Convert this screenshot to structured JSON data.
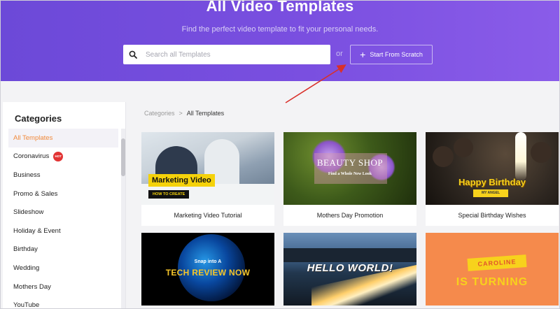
{
  "hero": {
    "title": "All Video Templates",
    "subtitle": "Find the perfect video template to fit your personal needs.",
    "search_placeholder": "Search all Templates",
    "or_label": "or",
    "scratch_button": "Start From Scratch"
  },
  "sidebar": {
    "title": "Categories",
    "items": [
      {
        "label": "All Templates",
        "active": true
      },
      {
        "label": "Coronavirus",
        "badge": "HOT"
      },
      {
        "label": "Business"
      },
      {
        "label": "Promo & Sales"
      },
      {
        "label": "Slideshow"
      },
      {
        "label": "Holiday & Event"
      },
      {
        "label": "Birthday"
      },
      {
        "label": "Wedding"
      },
      {
        "label": "Mothers Day"
      },
      {
        "label": "YouTube"
      }
    ]
  },
  "breadcrumb": {
    "root": "Categories",
    "separator": ">",
    "current": "All Templates"
  },
  "cards": [
    {
      "title": "Marketing Video Tutorial",
      "thumb_text": [
        "Marketing Video",
        "HOW TO CREATE"
      ]
    },
    {
      "title": "Mothers Day Promotion",
      "thumb_text": [
        "BEAUTY SHOP",
        "Find a Whole New Look"
      ]
    },
    {
      "title": "Special Birthday Wishes",
      "thumb_text": [
        "Happy Birthday",
        "MY ANGEL"
      ]
    },
    {
      "title": "",
      "thumb_text": [
        "Snap into A",
        "TECH REVIEW NOW"
      ]
    },
    {
      "title": "",
      "thumb_text": [
        "HELLO WORLD!"
      ]
    },
    {
      "title": "",
      "thumb_text": [
        "CAROLINE",
        "IS TURNING"
      ]
    }
  ],
  "colors": {
    "hero_gradient_start": "#6c49d8",
    "hero_gradient_end": "#8a5ce9",
    "active_category": "#f08a3c",
    "hot_badge": "#e23434",
    "annotation_arrow": "#d9302a"
  },
  "icons": {
    "search": "search-icon",
    "plus": "plus-icon"
  }
}
